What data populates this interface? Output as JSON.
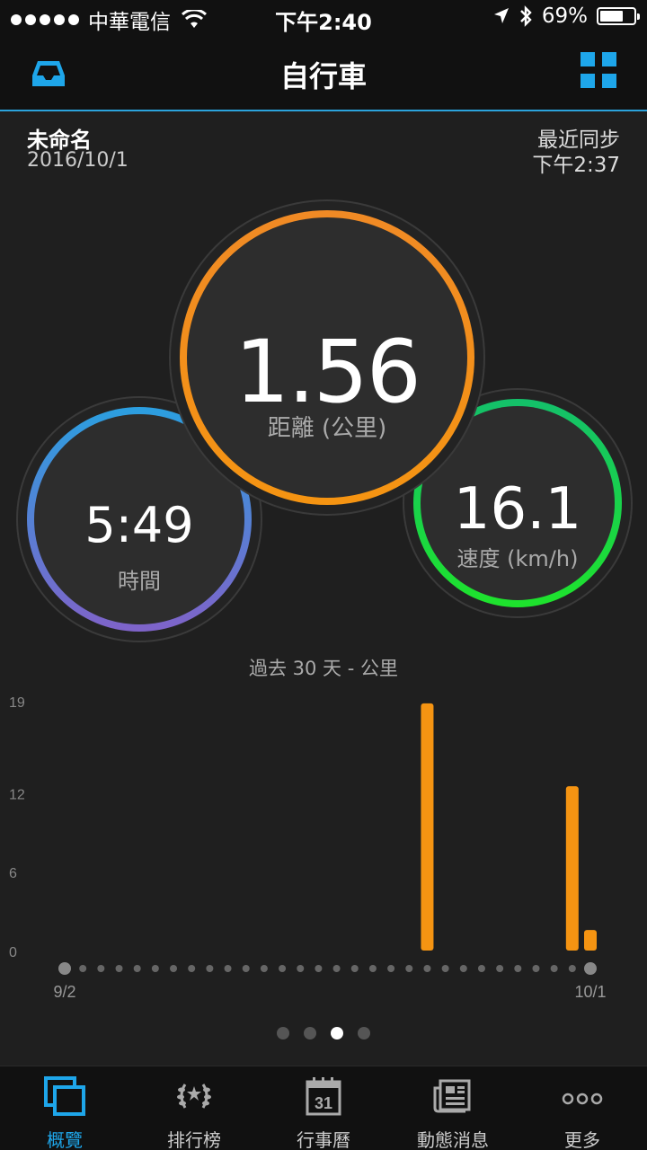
{
  "status_bar": {
    "carrier": "中華電信",
    "time": "下午2:40",
    "battery": "69%",
    "battery_level": 0.69
  },
  "header": {
    "title": "自行車",
    "inbox_icon": "inbox-icon",
    "grid_icon": "grid-icon"
  },
  "activity": {
    "name": "未命名",
    "date": "2016/10/1",
    "sync_label": "最近同步",
    "sync_time": "下午2:37"
  },
  "metrics": {
    "distance": {
      "value": "1.56",
      "label": "距離 (公里)"
    },
    "time": {
      "value": "5:49",
      "label": "時間"
    },
    "speed": {
      "value": "16.1",
      "label": "速度 (km/h)"
    }
  },
  "chart_title": "過去 30 天 - 公里",
  "chart_data": {
    "type": "bar",
    "title": "過去 30 天 - 公里",
    "ytick_labels": [
      "19",
      "12",
      "6",
      "0"
    ],
    "yticks": [
      19,
      12,
      6,
      0
    ],
    "ylim": [
      0,
      19
    ],
    "x_start_label": "9/2",
    "x_end_label": "10/1",
    "day_count": 30,
    "values": [
      0,
      0,
      0,
      0,
      0,
      0,
      0,
      0,
      0,
      0,
      0,
      0,
      0,
      0,
      0,
      0,
      0,
      0,
      0,
      0,
      18.8,
      0,
      0,
      0,
      0,
      0,
      0,
      0,
      12.5,
      1.56
    ],
    "bar_color": "#f59412",
    "grid": false
  },
  "pager": {
    "count": 4,
    "active_index": 2
  },
  "tabs": [
    {
      "label": "概覽",
      "icon": "overview-icon",
      "active": true
    },
    {
      "label": "排行榜",
      "icon": "laurel-icon",
      "active": false
    },
    {
      "label": "行事曆",
      "icon": "calendar-icon",
      "active": false,
      "icon_text": "31"
    },
    {
      "label": "動態消息",
      "icon": "newsfeed-icon",
      "active": false
    },
    {
      "label": "更多",
      "icon": "more-icon",
      "active": false
    }
  ]
}
